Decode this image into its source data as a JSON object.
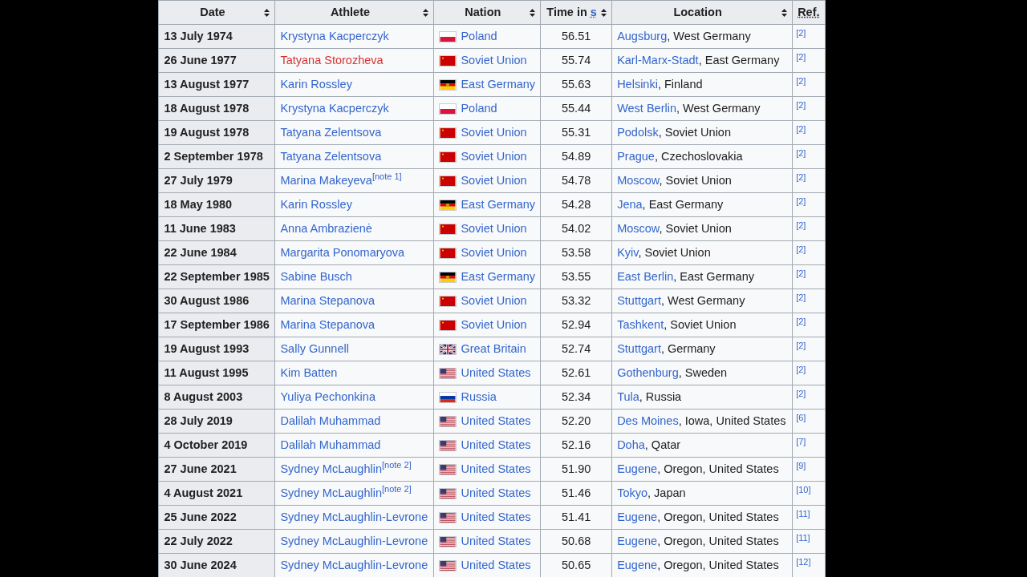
{
  "columns": [
    {
      "label": "Date",
      "sortable": true
    },
    {
      "label": "Athlete",
      "sortable": true
    },
    {
      "label": "Nation",
      "sortable": true
    },
    {
      "label": "Time in",
      "unit": "s",
      "sortable": true
    },
    {
      "label": "Location",
      "sortable": true
    },
    {
      "label": "Ref.",
      "sortable": false
    }
  ],
  "rows": [
    {
      "date": "13 July 1974",
      "athlete": "Krystyna Kacperczyk",
      "missing": false,
      "kind": "poland",
      "nation": "Poland",
      "time": "56.51",
      "place": "Augsburg",
      "place_rest": ", West Germany",
      "ref": "[2]"
    },
    {
      "date": "26 June 1977",
      "athlete": "Tatyana Storozheva",
      "missing": true,
      "kind": "ussr",
      "nation": "Soviet Union",
      "time": "55.74",
      "place": "Karl-Marx-Stadt",
      "place_rest": ", East Germany",
      "ref": "[2]"
    },
    {
      "date": "13 August 1977",
      "athlete": "Karin Rossley",
      "missing": false,
      "kind": "gdr",
      "nation": "East Germany",
      "time": "55.63",
      "place": "Helsinki",
      "place_rest": ", Finland",
      "ref": "[2]"
    },
    {
      "date": "18 August 1978",
      "athlete": "Krystyna Kacperczyk",
      "missing": false,
      "kind": "poland",
      "nation": "Poland",
      "time": "55.44",
      "place": "West Berlin",
      "place_rest": ", West Germany",
      "ref": "[2]"
    },
    {
      "date": "19 August 1978",
      "athlete": "Tatyana Zelentsova",
      "missing": false,
      "kind": "ussr",
      "nation": "Soviet Union",
      "time": "55.31",
      "place": "Podolsk",
      "place_rest": ", Soviet Union",
      "ref": "[2]"
    },
    {
      "date": "2 September 1978",
      "athlete": "Tatyana Zelentsova",
      "missing": false,
      "kind": "ussr",
      "nation": "Soviet Union",
      "time": "54.89",
      "place": "Prague",
      "place_rest": ", Czechoslovakia",
      "ref": "[2]"
    },
    {
      "date": "27 July 1979",
      "athlete": "Marina Makeyeva",
      "note": "[note 1]",
      "missing": false,
      "kind": "ussr",
      "nation": "Soviet Union",
      "time": "54.78",
      "place": "Moscow",
      "place_rest": ", Soviet Union",
      "ref": "[2]"
    },
    {
      "date": "18 May 1980",
      "athlete": "Karin Rossley",
      "missing": false,
      "kind": "gdr",
      "nation": "East Germany",
      "time": "54.28",
      "place": "Jena",
      "place_rest": ", East Germany",
      "ref": "[2]"
    },
    {
      "date": "11 June 1983",
      "athlete": "Anna Ambrazienė",
      "missing": false,
      "kind": "ussr",
      "nation": "Soviet Union",
      "time": "54.02",
      "place": "Moscow",
      "place_rest": ", Soviet Union",
      "ref": "[2]"
    },
    {
      "date": "22 June 1984",
      "athlete": "Margarita Ponomaryova",
      "missing": false,
      "kind": "ussr",
      "nation": "Soviet Union",
      "time": "53.58",
      "place": "Kyiv",
      "place_rest": ", Soviet Union",
      "ref": "[2]"
    },
    {
      "date": "22 September 1985",
      "athlete": "Sabine Busch",
      "missing": false,
      "kind": "gdr",
      "nation": "East Germany",
      "time": "53.55",
      "place": "East Berlin",
      "place_rest": ", East Germany",
      "ref": "[2]"
    },
    {
      "date": "30 August 1986",
      "athlete": "Marina Stepanova",
      "missing": false,
      "kind": "ussr",
      "nation": "Soviet Union",
      "time": "53.32",
      "place": "Stuttgart",
      "place_rest": ", West Germany",
      "ref": "[2]"
    },
    {
      "date": "17 September 1986",
      "athlete": "Marina Stepanova",
      "missing": false,
      "kind": "ussr",
      "nation": "Soviet Union",
      "time": "52.94",
      "place": "Tashkent",
      "place_rest": ", Soviet Union",
      "ref": "[2]"
    },
    {
      "date": "19 August 1993",
      "athlete": "Sally Gunnell",
      "missing": false,
      "kind": "uk",
      "nation": "Great Britain",
      "time": "52.74",
      "place": "Stuttgart",
      "place_rest": ", Germany",
      "ref": "[2]"
    },
    {
      "date": "11 August 1995",
      "athlete": "Kim Batten",
      "missing": false,
      "kind": "usa",
      "nation": "United States",
      "time": "52.61",
      "place": "Gothenburg",
      "place_rest": ", Sweden",
      "ref": "[2]"
    },
    {
      "date": "8 August 2003",
      "athlete": "Yuliya Pechonkina",
      "missing": false,
      "kind": "russia",
      "nation": "Russia",
      "time": "52.34",
      "place": "Tula",
      "place_rest": ", Russia",
      "ref": "[2]"
    },
    {
      "date": "28 July 2019",
      "athlete": "Dalilah Muhammad",
      "missing": false,
      "kind": "usa",
      "nation": "United States",
      "time": "52.20",
      "place": "Des Moines",
      "place_rest": ", Iowa, United States",
      "ref": "[6]"
    },
    {
      "date": "4 October 2019",
      "athlete": "Dalilah Muhammad",
      "missing": false,
      "kind": "usa",
      "nation": "United States",
      "time": "52.16",
      "place": "Doha",
      "place_rest": ", Qatar",
      "ref": "[7]"
    },
    {
      "date": "27 June 2021",
      "athlete": "Sydney McLaughlin",
      "note": "[note 2]",
      "missing": false,
      "kind": "usa",
      "nation": "United States",
      "time": "51.90",
      "place": "Eugene",
      "place_rest": ", Oregon, United States",
      "ref": "[9]"
    },
    {
      "date": "4 August 2021",
      "athlete": "Sydney McLaughlin",
      "note": "[note 2]",
      "missing": false,
      "kind": "usa",
      "nation": "United States",
      "time": "51.46",
      "place": "Tokyo",
      "place_rest": ", Japan",
      "ref": "[10]"
    },
    {
      "date": "25 June 2022",
      "athlete": "Sydney McLaughlin-Levrone",
      "missing": false,
      "kind": "usa",
      "nation": "United States",
      "time": "51.41",
      "place": "Eugene",
      "place_rest": ", Oregon, United States",
      "ref": "[11]"
    },
    {
      "date": "22 July 2022",
      "athlete": "Sydney McLaughlin-Levrone",
      "missing": false,
      "kind": "usa",
      "nation": "United States",
      "time": "50.68",
      "place": "Eugene",
      "place_rest": ", Oregon, United States",
      "ref": "[11]"
    },
    {
      "date": "30 June 2024",
      "athlete": "Sydney McLaughlin-Levrone",
      "missing": false,
      "kind": "usa",
      "nation": "United States",
      "time": "50.65",
      "place": "Eugene",
      "place_rest": ", Oregon, United States",
      "ref": "[12]"
    }
  ]
}
